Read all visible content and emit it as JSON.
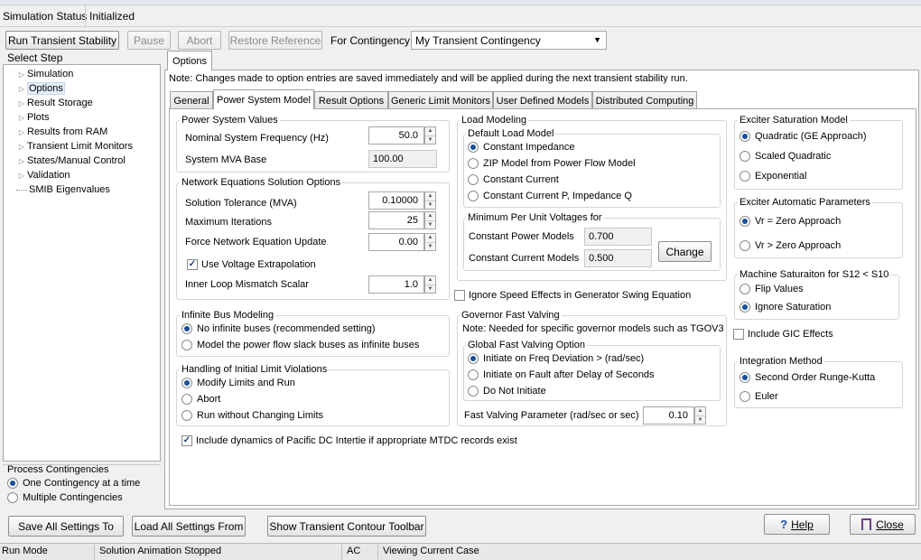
{
  "status": {
    "label": "Simulation Status",
    "value": "Initialized"
  },
  "toolbar": {
    "run": "Run Transient Stability",
    "pause": "Pause",
    "abort": "Abort",
    "restore": "Restore Reference",
    "contingency_label": "For Contingency:",
    "contingency_value": "My Transient Contingency"
  },
  "steps": {
    "header": "Select Step",
    "items": [
      "Simulation",
      "Options",
      "Result Storage",
      "Plots",
      "Results from RAM",
      "Transient Limit Monitors",
      "States/Manual Control",
      "Validation",
      "SMIB Eigenvalues"
    ]
  },
  "process": {
    "title": "Process Contingencies",
    "one": "One Contingency at a time",
    "multiple": "Multiple Contingencies"
  },
  "options_tab": "Options",
  "note": "Note: Changes made to option entries are saved immediately and will be applied during the next transient stability run.",
  "tabs": [
    "General",
    "Power System Model",
    "Result Options",
    "Generic Limit Monitors",
    "User Defined Models",
    "Distributed Computing"
  ],
  "psv": {
    "title": "Power System Values",
    "freq_label": "Nominal System Frequency (Hz)",
    "freq_value": "50.0",
    "mva_label": "System MVA Base",
    "mva_value": "100.00"
  },
  "nes": {
    "title": "Network Equations Solution Options",
    "tol_label": "Solution Tolerance (MVA)",
    "tol_value": "0.10000",
    "iter_label": "Maximum Iterations",
    "iter_value": "25",
    "force_label": "Force Network Equation Update",
    "force_value": "0.00",
    "extrap_label": "Use Voltage Extrapolation",
    "inner_label": "Inner Loop Mismatch Scalar",
    "inner_value": "1.0"
  },
  "inf": {
    "title": "Infinite Bus Modeling",
    "opt1": "No infinite buses (recommended setting)",
    "opt2": "Model the power flow slack buses as infinite buses"
  },
  "hil": {
    "title": "Handling of Initial Limit Violations",
    "opt1": "Modify Limits and Run",
    "opt2": "Abort",
    "opt3": "Run without Changing Limits"
  },
  "pacific": "Include dynamics of Pacific DC Intertie if appropriate MTDC records exist",
  "load": {
    "title": "Load Modeling",
    "dlm_title": "Default Load Model",
    "opt1": "Constant Impedance",
    "opt2": "ZIP Model from Power Flow Model",
    "opt3": "Constant Current",
    "opt4": "Constant Current P, Impedance Q",
    "minv_title": "Minimum Per Unit Voltages for",
    "cp_label": "Constant Power Models",
    "cp_value": "0.700",
    "cc_label": "Constant Current Models",
    "cc_value": "0.500",
    "change": "Change"
  },
  "ignore_speed": "Ignore Speed Effects in Generator Swing Equation",
  "gfv": {
    "title": "Governor Fast Valving",
    "note": "Note: Needed for specific governor models such as TGOV3",
    "global_title": "Global Fast Valving Option",
    "opt1": "Initiate on Freq Deviation > (rad/sec)",
    "opt2": "Initiate on Fault after Delay of Seconds",
    "opt3": "Do Not Initiate",
    "param_label": "Fast Valving Parameter (rad/sec or sec)",
    "param_value": "0.10"
  },
  "esm": {
    "title": "Exciter Saturation Model",
    "opt1": "Quadratic (GE Approach)",
    "opt2": "Scaled Quadratic",
    "opt3": "Exponential"
  },
  "eap": {
    "title": "Exciter Automatic Parameters",
    "opt1": "Vr = Zero Approach",
    "opt2": "Vr > Zero Approach"
  },
  "msat": {
    "title": "Machine Saturaiton for S12 < S10",
    "opt1": "Flip Values",
    "opt2": "Ignore Saturation"
  },
  "gic": "Include GIC Effects",
  "integ": {
    "title": "Integration Method",
    "opt1": "Second Order Runge-Kutta",
    "opt2": "Euler"
  },
  "footer": {
    "save": "Save All Settings To",
    "load": "Load All Settings From",
    "contour": "Show Transient Contour Toolbar",
    "help": "Help",
    "close": "Close"
  },
  "statusbar": {
    "mode": "Run Mode",
    "anim": "Solution Animation Stopped",
    "ac": "AC",
    "case": "Viewing Current Case"
  }
}
